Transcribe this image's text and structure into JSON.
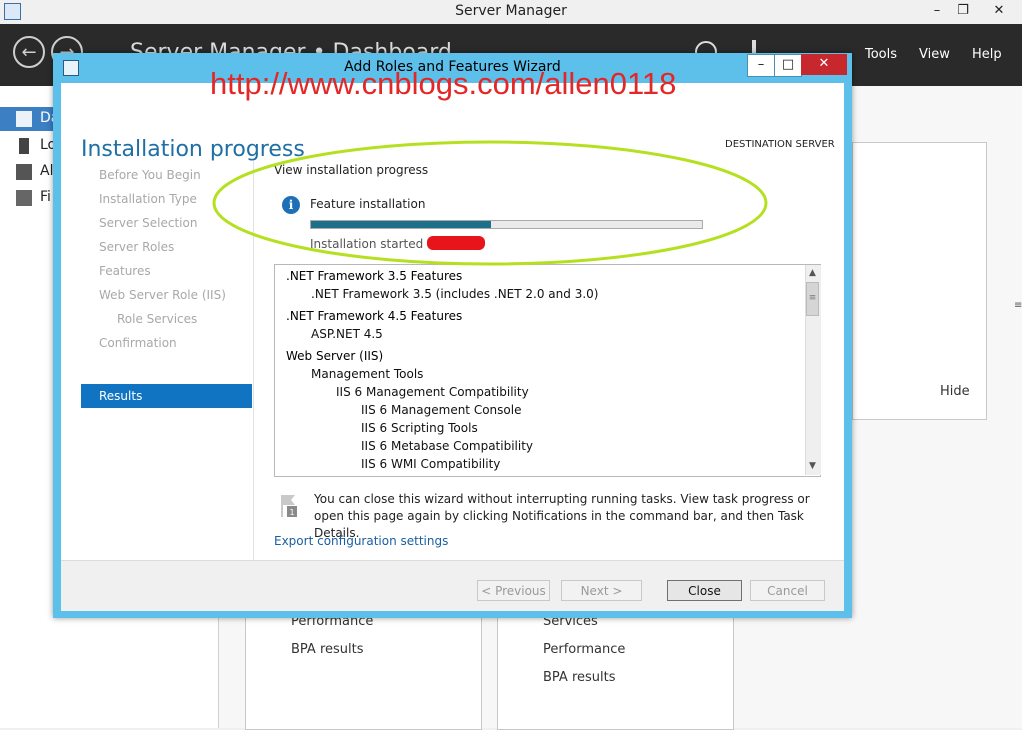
{
  "server_manager": {
    "title": "Server Manager",
    "window_controls": {
      "minimize": "–",
      "restore": "❐",
      "close": "✕"
    },
    "breadcrumb": "Server Manager • Dashboard",
    "menu": {
      "tools": "Tools",
      "view": "View",
      "help": "Help"
    },
    "sidebar": [
      {
        "label": "Da",
        "icon": "dashboard-icon"
      },
      {
        "label": "Lo",
        "icon": "local-server-icon"
      },
      {
        "label": "Al",
        "icon": "all-servers-icon"
      },
      {
        "label": "Fi",
        "icon": "file-services-icon"
      }
    ],
    "hide_label": "Hide",
    "tiles": {
      "left": [
        "Performance",
        "BPA results"
      ],
      "right": [
        "Services",
        "Performance",
        "BPA results"
      ]
    }
  },
  "wizard": {
    "title": "Add Roles and Features Wizard",
    "heading": "Installation progress",
    "destination_label": "DESTINATION SERVER",
    "steps": [
      {
        "label": "Before You Begin",
        "indent": false
      },
      {
        "label": "Installation Type",
        "indent": false
      },
      {
        "label": "Server Selection",
        "indent": false
      },
      {
        "label": "Server Roles",
        "indent": false
      },
      {
        "label": "Features",
        "indent": false
      },
      {
        "label": "Web Server Role (IIS)",
        "indent": false
      },
      {
        "label": "Role Services",
        "indent": true
      },
      {
        "label": "Confirmation",
        "indent": false
      },
      {
        "label": "Results",
        "indent": false,
        "active": true
      }
    ],
    "view_progress": "View installation progress",
    "feature_install": "Feature installation",
    "progress_fraction": 0.46,
    "install_started": "Installation started on",
    "items": [
      {
        "text": ".NET Framework 3.5 Features",
        "level": 0
      },
      {
        "text": ".NET Framework 3.5 (includes .NET 2.0 and 3.0)",
        "level": 1
      },
      {
        "text": ".NET Framework 4.5 Features",
        "level": 0
      },
      {
        "text": "ASP.NET 4.5",
        "level": 1
      },
      {
        "text": "Web Server (IIS)",
        "level": 0
      },
      {
        "text": "Management Tools",
        "level": 1
      },
      {
        "text": "IIS 6 Management Compatibility",
        "level": 2
      },
      {
        "text": "IIS 6 Management Console",
        "level": 3
      },
      {
        "text": "IIS 6 Scripting Tools",
        "level": 3
      },
      {
        "text": "IIS 6 Metabase Compatibility",
        "level": 3
      },
      {
        "text": "IIS 6 WMI Compatibility",
        "level": 3
      }
    ],
    "close_note": "You can close this wizard without interrupting running tasks. View task progress or open this page again by clicking Notifications in the command bar, and then Task Details.",
    "notification_badge": "1",
    "export_link": "Export configuration settings",
    "buttons": {
      "previous": "< Previous",
      "next": "Next >",
      "close": "Close",
      "cancel": "Cancel"
    }
  },
  "watermark": "http://www.cnblogs.com/allen0118",
  "colors": {
    "accent": "#1174c3",
    "wizard_frame": "#5cc0ea",
    "highlight_ellipse": "#b5e01f",
    "watermark": "#e52626"
  }
}
